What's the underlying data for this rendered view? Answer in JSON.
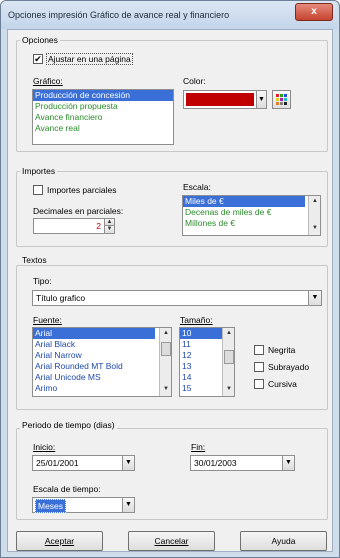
{
  "window": {
    "title": "Opciones impresión Gráfico de avance real y financiero",
    "close_label": "x"
  },
  "opciones": {
    "legend": "Opciones",
    "ajustar": {
      "label": "Ajustar en una página",
      "checked": true
    },
    "grafico_label": "Gráfico:",
    "grafico_items": [
      "Producción de concesión",
      "Producción propuesta",
      "Avance financiero",
      "Avance real"
    ],
    "color_label": "Color:",
    "color_value": "#c00000"
  },
  "importes": {
    "legend": "Importes",
    "parciales_label": "Importes parciales",
    "decimales_label": "Decimales en parciales:",
    "decimales_value": "2",
    "escala_label": "Escala:",
    "escala_items": [
      "Miles de €",
      "Decenas de miles de €",
      "Millones de €"
    ]
  },
  "textos": {
    "legend": "Textos",
    "tipo_label": "Tipo:",
    "tipo_value": "Título grafico",
    "fuente_label": "Fuente:",
    "fuente_items": [
      "Arial",
      "Arial Black",
      "Arial Narrow",
      "Arial Rounded MT Bold",
      "Arial Unicode MS",
      "Arimo"
    ],
    "tamano_label": "Tamaño:",
    "tamano_items": [
      "10",
      "11",
      "12",
      "13",
      "14",
      "15"
    ],
    "negrita": "Negrita",
    "subrayado": "Subrayado",
    "cursiva": "Cursiva"
  },
  "periodo": {
    "legend": "Periodo de tiempo (dias)",
    "inicio_label": "Inicio:",
    "inicio_value": "25/01/2001",
    "fin_label": "Fin:",
    "fin_value": "30/01/2003",
    "escala_label": "Escala de tiempo:",
    "escala_value": "Meses"
  },
  "buttons": {
    "aceptar": "Aceptar",
    "cancelar": "Cancelar",
    "ayuda": "Ayuda"
  }
}
